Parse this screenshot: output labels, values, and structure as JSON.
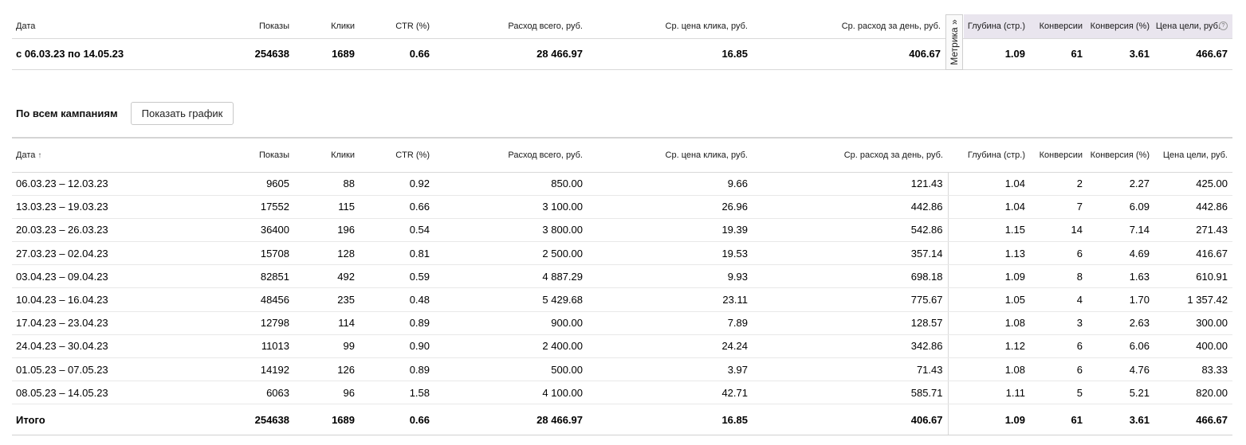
{
  "columns": {
    "date": "Дата",
    "impressions": "Показы",
    "clicks": "Клики",
    "ctr": "CTR (%)",
    "spend": "Расход всего, руб.",
    "cpc": "Ср. цена клика, руб.",
    "daily_spend": "Ср. расход за день, руб.",
    "depth": "Глубина (стр.)",
    "conversions": "Конверсии",
    "conversion_rate": "Конверсия (%)",
    "goal_cost": "Цена цели, руб."
  },
  "summary": {
    "period": "с 06.03.23 по 14.05.23",
    "impressions": "254638",
    "clicks": "1689",
    "ctr": "0.66",
    "spend": "28 466.97",
    "cpc": "16.85",
    "daily_spend": "406.67",
    "depth": "1.09",
    "conversions": "61",
    "conversion_rate": "3.61",
    "goal_cost": "466.67"
  },
  "metrika_toggle": "Метрика »",
  "toolbar": {
    "all_campaigns": "По всем кампаниям",
    "show_chart": "Показать график"
  },
  "sort_arrow": "↑",
  "rows": [
    {
      "date": "06.03.23 – 12.03.23",
      "impressions": "9605",
      "clicks": "88",
      "ctr": "0.92",
      "spend": "850.00",
      "cpc": "9.66",
      "daily_spend": "121.43",
      "depth": "1.04",
      "conversions": "2",
      "conversion_rate": "2.27",
      "goal_cost": "425.00"
    },
    {
      "date": "13.03.23 – 19.03.23",
      "impressions": "17552",
      "clicks": "115",
      "ctr": "0.66",
      "spend": "3 100.00",
      "cpc": "26.96",
      "daily_spend": "442.86",
      "depth": "1.04",
      "conversions": "7",
      "conversion_rate": "6.09",
      "goal_cost": "442.86"
    },
    {
      "date": "20.03.23 – 26.03.23",
      "impressions": "36400",
      "clicks": "196",
      "ctr": "0.54",
      "spend": "3 800.00",
      "cpc": "19.39",
      "daily_spend": "542.86",
      "depth": "1.15",
      "conversions": "14",
      "conversion_rate": "7.14",
      "goal_cost": "271.43"
    },
    {
      "date": "27.03.23 – 02.04.23",
      "impressions": "15708",
      "clicks": "128",
      "ctr": "0.81",
      "spend": "2 500.00",
      "cpc": "19.53",
      "daily_spend": "357.14",
      "depth": "1.13",
      "conversions": "6",
      "conversion_rate": "4.69",
      "goal_cost": "416.67"
    },
    {
      "date": "03.04.23 – 09.04.23",
      "impressions": "82851",
      "clicks": "492",
      "ctr": "0.59",
      "spend": "4 887.29",
      "cpc": "9.93",
      "daily_spend": "698.18",
      "depth": "1.09",
      "conversions": "8",
      "conversion_rate": "1.63",
      "goal_cost": "610.91"
    },
    {
      "date": "10.04.23 – 16.04.23",
      "impressions": "48456",
      "clicks": "235",
      "ctr": "0.48",
      "spend": "5 429.68",
      "cpc": "23.11",
      "daily_spend": "775.67",
      "depth": "1.05",
      "conversions": "4",
      "conversion_rate": "1.70",
      "goal_cost": "1 357.42"
    },
    {
      "date": "17.04.23 – 23.04.23",
      "impressions": "12798",
      "clicks": "114",
      "ctr": "0.89",
      "spend": "900.00",
      "cpc": "7.89",
      "daily_spend": "128.57",
      "depth": "1.08",
      "conversions": "3",
      "conversion_rate": "2.63",
      "goal_cost": "300.00"
    },
    {
      "date": "24.04.23 – 30.04.23",
      "impressions": "11013",
      "clicks": "99",
      "ctr": "0.90",
      "spend": "2 400.00",
      "cpc": "24.24",
      "daily_spend": "342.86",
      "depth": "1.12",
      "conversions": "6",
      "conversion_rate": "6.06",
      "goal_cost": "400.00"
    },
    {
      "date": "01.05.23 – 07.05.23",
      "impressions": "14192",
      "clicks": "126",
      "ctr": "0.89",
      "spend": "500.00",
      "cpc": "3.97",
      "daily_spend": "71.43",
      "depth": "1.08",
      "conversions": "6",
      "conversion_rate": "4.76",
      "goal_cost": "83.33"
    },
    {
      "date": "08.05.23 – 14.05.23",
      "impressions": "6063",
      "clicks": "96",
      "ctr": "1.58",
      "spend": "4 100.00",
      "cpc": "42.71",
      "daily_spend": "585.71",
      "depth": "1.11",
      "conversions": "5",
      "conversion_rate": "5.21",
      "goal_cost": "820.00"
    }
  ],
  "total": {
    "label": "Итого",
    "impressions": "254638",
    "clicks": "1689",
    "ctr": "0.66",
    "spend": "28 466.97",
    "cpc": "16.85",
    "daily_spend": "406.67",
    "depth": "1.09",
    "conversions": "61",
    "conversion_rate": "3.61",
    "goal_cost": "466.67"
  }
}
